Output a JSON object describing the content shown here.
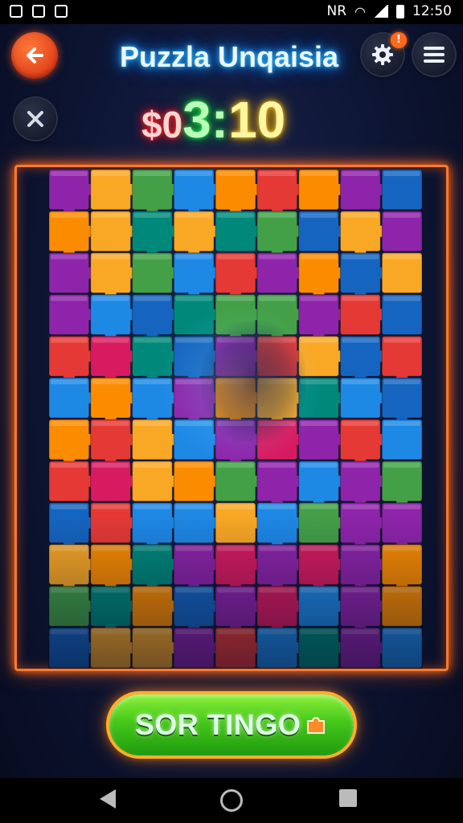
{
  "status_bar": {
    "time": "12:50",
    "network": "NR"
  },
  "header": {
    "title": "Puzzla Unqaisia",
    "settings_badge": "!"
  },
  "timer": {
    "part_a": "$0",
    "part_b": "3:",
    "part_c": "10"
  },
  "action": {
    "sort_label": "SOR TINGO"
  },
  "colors": {
    "frame": "#ff7a2a",
    "piece_palette": [
      "#1e88e5",
      "#f9a825",
      "#e53935",
      "#43a047",
      "#8e24aa",
      "#fb8c00",
      "#1565c0",
      "#d81b60",
      "#00897b"
    ]
  }
}
